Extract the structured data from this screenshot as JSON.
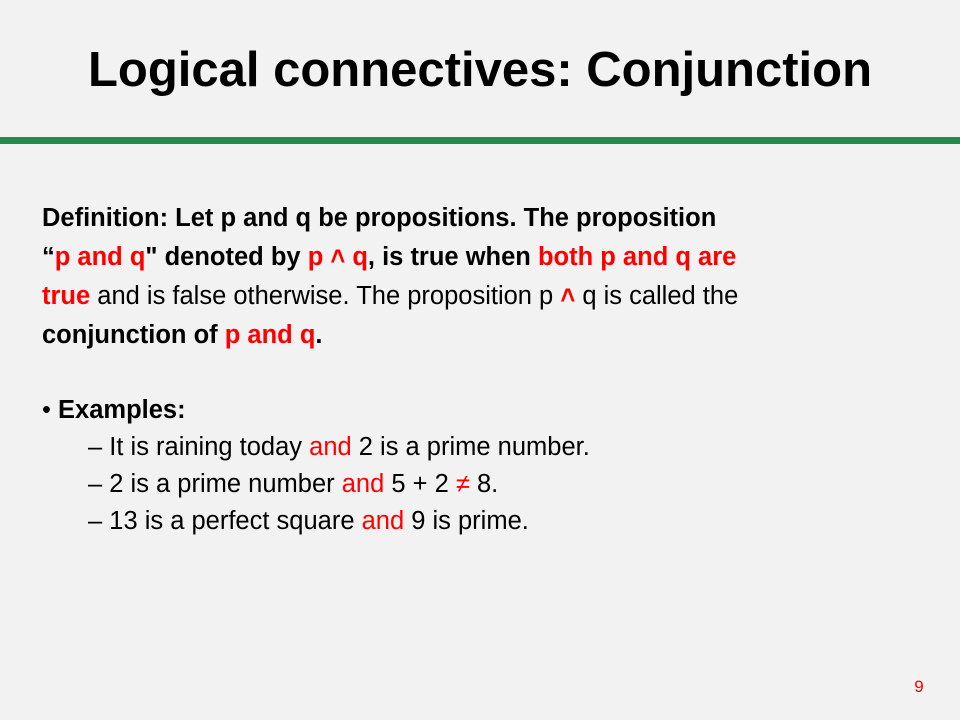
{
  "slide": {
    "title": "Logical connectives: Conjunction",
    "page_number": "9",
    "accent_color": "#1e8a4c",
    "highlight_color": "#ff0000"
  },
  "definition": {
    "d1": "Definition: Let p and q be propositions. The proposition",
    "d2_quote_open": "“",
    "d2_pq": "p and q",
    "d2_quote_close": "\"",
    "d2_denoted": " denoted by ",
    "d2_expr": "p ˄ q",
    "d2_true_when": ", is true when ",
    "d2_both": "both p and q are",
    "d3_true": "true",
    "d3_rest1": " and is false otherwise. The proposition p ",
    "d3_wedge": "˄",
    "d3_rest2": " q is called the",
    "d4_conj": "conjunction of ",
    "d4_pq": "p and q",
    "d4_period": "."
  },
  "examples": {
    "bullet": "•",
    "heading": "Examples:",
    "items": [
      {
        "dash": "–",
        "pre": " It is raining today ",
        "and": "and",
        "post": " 2 is a prime number."
      },
      {
        "dash": "–",
        "pre": " 2 is a prime number ",
        "and": "and",
        "post": " 5 + 2 ",
        "neq": "≠",
        "post2": " 8."
      },
      {
        "dash": "–",
        "pre": " 13 is a perfect square ",
        "and": "and",
        "post": " 9 is prime."
      }
    ]
  }
}
